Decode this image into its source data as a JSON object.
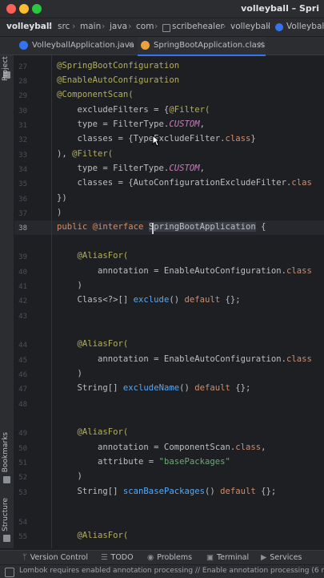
{
  "window": {
    "title": "volleyball – Spri"
  },
  "breadcrumb": {
    "items": [
      "volleyball",
      "src",
      "main",
      "java",
      "com",
      "scribehealer",
      "volleyball",
      "Volleyball"
    ]
  },
  "tabs": [
    {
      "label": "VolleyballApplication.java",
      "active": false,
      "icon_color": "#3574f0"
    },
    {
      "label": "SpringBootApplication.class",
      "active": true,
      "icon_color": "#e8a33d"
    }
  ],
  "sidebar": {
    "top_label": "Project",
    "bottom_labels": [
      "Bookmarks",
      "Structure"
    ]
  },
  "editor": {
    "line_numbers": [
      "27",
      "28",
      "29",
      "30",
      "31",
      "32",
      "33",
      "34",
      "35",
      "36",
      "37",
      "38",
      "39",
      "40",
      "41",
      "42",
      "43",
      "44",
      "45",
      "46",
      "47",
      "48",
      "49",
      "50",
      "51",
      "52",
      "53",
      "54",
      "55"
    ],
    "current_line": "38",
    "code": {
      "l27": "@SpringBootConfiguration",
      "l28": "@EnableAutoConfiguration",
      "l29": "@ComponentScan(",
      "l30a": "    excludeFilters = {",
      "l30b": "@Filter(",
      "l31a": "    type = FilterType.",
      "l31b": "CUSTOM",
      "l31c": ",",
      "l32a": "    classes = {TypeExcludeFilter.",
      "l32b": "class",
      "l32c": "}",
      "l33a": "), ",
      "l33b": "@Filter(",
      "l34a": "    type = FilterType.",
      "l34b": "CUSTOM",
      "l34c": ",",
      "l35a": "    classes = {AutoConfigurationExcludeFilter.",
      "l35b": "clas",
      "l36": "})",
      "l37": ")",
      "l38a": "public ",
      "l38b": "@interface ",
      "l38c": "SpringBootApplication",
      "l38d": " {",
      "l40": "    @AliasFor(",
      "l41a": "        annotation = EnableAutoConfiguration.",
      "l41b": "class",
      "l42": "    )",
      "l43a": "    Class<?>[] ",
      "l43b": "exclude",
      "l43c": "() ",
      "l43d": "default",
      "l43e": " {};",
      "l46": "    @AliasFor(",
      "l47a": "        annotation = EnableAutoConfiguration.",
      "l47b": "class",
      "l48": "    )",
      "l49a": "    String[] ",
      "l49b": "excludeName",
      "l49c": "() ",
      "l49d": "default",
      "l49e": " {};",
      "l52": "    @AliasFor(",
      "l53a": "        annotation = ComponentScan.",
      "l53b": "class",
      "l53c": ",",
      "l54a": "        attribute = ",
      "l54b": "\"basePackages\"",
      "l55": "    )",
      "l56a": "    String[] ",
      "l56b": "scanBasePackages",
      "l56c": "() ",
      "l56d": "default",
      "l56e": " {};",
      "l59": "    @AliasFor("
    }
  },
  "toolwindows": [
    {
      "label": "Version Control",
      "icon": "branch-icon"
    },
    {
      "label": "TODO",
      "icon": "list-icon"
    },
    {
      "label": "Problems",
      "icon": "warning-icon"
    },
    {
      "label": "Terminal",
      "icon": "terminal-icon"
    },
    {
      "label": "Services",
      "icon": "services-icon"
    }
  ],
  "status": {
    "message": "Lombok requires enabled annotation processing // Enable annotation processing (6 min"
  }
}
